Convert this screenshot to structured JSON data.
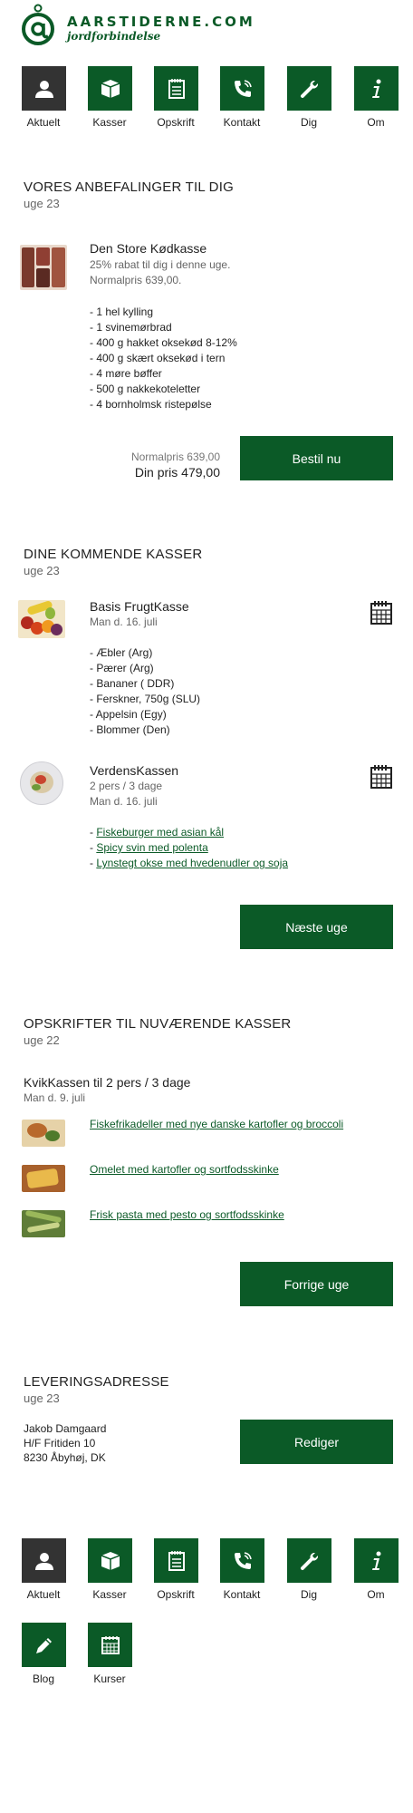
{
  "brand": {
    "name": "AARSTIDERNE.COM",
    "tagline": "jordforbindelse"
  },
  "nav_top": [
    {
      "label": "Aktuelt",
      "icon": "person-icon"
    },
    {
      "label": "Kasser",
      "icon": "box-icon"
    },
    {
      "label": "Opskrift",
      "icon": "notepad-icon"
    },
    {
      "label": "Kontakt",
      "icon": "phone-icon"
    },
    {
      "label": "Dig",
      "icon": "wrench-icon"
    },
    {
      "label": "Om",
      "icon": "info-icon"
    }
  ],
  "recommendations": {
    "heading": "VORES ANBEFALINGER TIL DIG",
    "week": "uge 23",
    "product": {
      "title": "Den Store Kødkasse",
      "discount": "25% rabat til dig i denne uge.",
      "normal_price_text": "Normalpris 639,00.",
      "items": [
        "- 1 hel kylling",
        "- 1 svinemørbrad",
        "- 400 g hakket oksekød 8-12%",
        "- 400 g skært oksekød i tern",
        "- 4 møre bøffer",
        "- 500 g nakkekoteletter",
        "- 4 bornholmsk ristepølse"
      ],
      "normal_price_label": "Normalpris 639,00",
      "your_price_label": "Din pris 479,00",
      "order_button": "Bestil nu"
    }
  },
  "upcoming": {
    "heading": "DINE KOMMENDE KASSER",
    "week": "uge 23",
    "boxes": [
      {
        "title": "Basis FrugtKasse",
        "lines": [
          "Man d. 16. juli"
        ],
        "items": [
          "- Æbler (Arg)",
          "- Pærer (Arg)",
          "- Bananer ( DDR)",
          "- Ferskner, 750g (SLU)",
          "- Appelsin (Egy)",
          "- Blommer (Den)"
        ]
      },
      {
        "title": "VerdensKassen",
        "lines": [
          "2 pers / 3 dage",
          "Man d. 16. juli"
        ],
        "links": [
          "Fiskeburger med asian kål",
          "Spicy svin med polenta",
          "Lynstegt okse med hvedenudler og soja"
        ]
      }
    ],
    "next_button": "Næste uge"
  },
  "recipes": {
    "heading": "OPSKRIFTER TIL NUVÆRENDE KASSER",
    "week": "uge 22",
    "box_title": "KvikKassen til 2 pers / 3 dage",
    "box_date": "Man d. 9. juli",
    "items": [
      "Fiskefrikadeller med nye danske kartofler og broccoli",
      "Omelet med kartofler og sortfodsskinke",
      "Frisk pasta med pesto og sortfodsskinke"
    ],
    "prev_button": "Forrige uge"
  },
  "delivery": {
    "heading": "LEVERINGSADRESSE",
    "week": "uge 23",
    "name": "Jakob Damgaard",
    "street": "H/F Fritiden 10",
    "city": "8230 Åbyhøj, DK",
    "edit_button": "Rediger"
  },
  "nav_bottom": [
    {
      "label": "Aktuelt",
      "icon": "person-icon"
    },
    {
      "label": "Kasser",
      "icon": "box-icon"
    },
    {
      "label": "Opskrift",
      "icon": "notepad-icon"
    },
    {
      "label": "Kontakt",
      "icon": "phone-icon"
    },
    {
      "label": "Dig",
      "icon": "wrench-icon"
    },
    {
      "label": "Om",
      "icon": "info-icon"
    },
    {
      "label": "Blog",
      "icon": "pencil-icon"
    },
    {
      "label": "Kurser",
      "icon": "calendar-icon"
    }
  ],
  "colors": {
    "brand_green": "#0b5a27",
    "active_tile": "#333333",
    "muted_text": "#666666"
  }
}
